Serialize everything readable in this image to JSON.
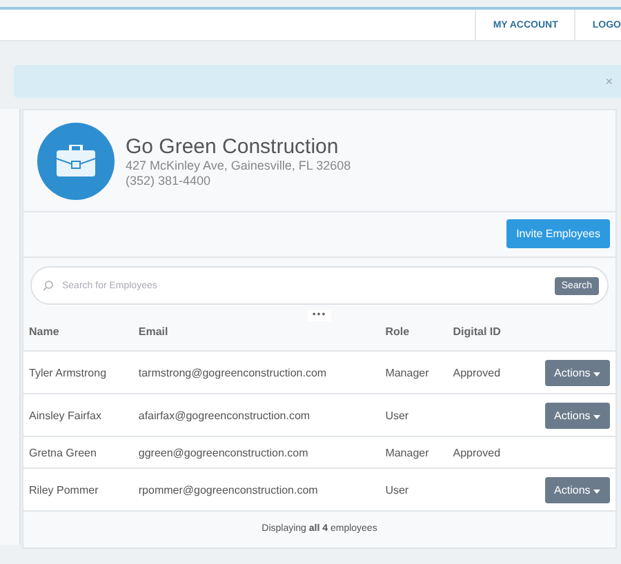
{
  "top_nav": {
    "links": [
      "MY ACCOUNT",
      "LOGO"
    ]
  },
  "alert": {
    "close": "×"
  },
  "company": {
    "name": "Go Green Construction",
    "address": "427 McKinley Ave, Gainesville, FL 32608",
    "phone": "(352) 381-4400"
  },
  "invite_button": "Invite Employees",
  "search": {
    "placeholder": "Search for Employees",
    "button": "Search"
  },
  "more": "•••",
  "table": {
    "columns": [
      "Name",
      "Email",
      "Role",
      "Digital ID"
    ],
    "rows": [
      {
        "name": "Tyler Armstrong",
        "email": "tarmstrong@gogreenconstruction.com",
        "role": "Manager",
        "digital_id": "Approved",
        "action": "Actions"
      },
      {
        "name": "Ainsley Fairfax",
        "email": "afairfax@gogreenconstruction.com",
        "role": "User",
        "action": "Actions"
      },
      {
        "name": "Gretna Green",
        "email": "ggreen@gogreenconstruction.com",
        "role": "Manager",
        "digital_id": "Approved"
      },
      {
        "name": "Riley Pommer",
        "email": "rpommer@gogreenconstruction.com",
        "role": "User",
        "action": "Actions"
      }
    ]
  },
  "footer": "Displaying **all 4** employees"
}
